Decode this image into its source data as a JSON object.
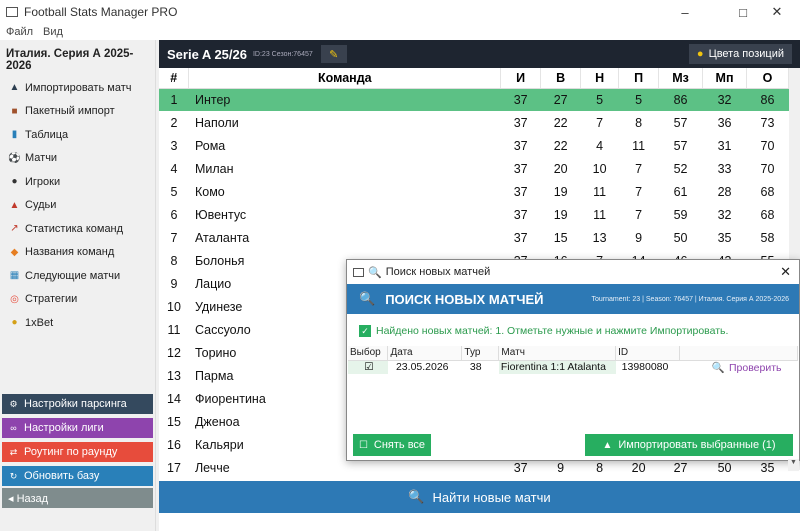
{
  "window": {
    "title": "Football Stats Manager PRO"
  },
  "menu": [
    "Файл",
    "Вид"
  ],
  "sidebar": {
    "league": "Италия. Серия А 2025-2026",
    "items": [
      {
        "label": "Импортировать матч",
        "icon": "import-icon"
      },
      {
        "label": "Пакетный импорт",
        "icon": "box-icon"
      },
      {
        "label": "Таблица",
        "icon": "bar-chart-icon"
      },
      {
        "label": "Матчи",
        "icon": "ball-icon"
      },
      {
        "label": "Игроки",
        "icon": "person-icon"
      },
      {
        "label": "Судьи",
        "icon": "referee-icon"
      },
      {
        "label": "Статистика команд",
        "icon": "line-chart-icon"
      },
      {
        "label": "Названия команд",
        "icon": "tag-icon"
      },
      {
        "label": "Следующие матчи",
        "icon": "calendar-icon"
      },
      {
        "label": "Стратегии",
        "icon": "target-icon"
      },
      {
        "label": "1xBet",
        "icon": "coin-icon"
      }
    ],
    "bottom_buttons": [
      {
        "label": "Настройки парсинга",
        "color": "#34495e",
        "icon": "gear-icon"
      },
      {
        "label": "Настройки лиги",
        "color": "#8e44ad",
        "icon": "link-icon"
      },
      {
        "label": "Роутинг по раунду",
        "color": "#e74c3c",
        "icon": "shuffle-icon"
      },
      {
        "label": "Обновить базу",
        "color": "#2980b9",
        "icon": "refresh-icon"
      },
      {
        "label": "◂ Назад",
        "color": "#7f8c8d",
        "icon": ""
      }
    ]
  },
  "main": {
    "header_title": "Serie A 25/26",
    "header_sub": "ID:23  Сезон:76457",
    "colors_button": "Цвета позиций",
    "find_button": "Найти новые матчи"
  },
  "table": {
    "columns": [
      "#",
      "Команда",
      "И",
      "В",
      "Н",
      "П",
      "Мз",
      "Мп",
      "О"
    ],
    "rows": [
      [
        "1",
        "Интер",
        "37",
        "27",
        "5",
        "5",
        "86",
        "32",
        "86"
      ],
      [
        "2",
        "Наполи",
        "37",
        "22",
        "7",
        "8",
        "57",
        "36",
        "73"
      ],
      [
        "3",
        "Рома",
        "37",
        "22",
        "4",
        "11",
        "57",
        "31",
        "70"
      ],
      [
        "4",
        "Милан",
        "37",
        "20",
        "10",
        "7",
        "52",
        "33",
        "70"
      ],
      [
        "5",
        "Комо",
        "37",
        "19",
        "11",
        "7",
        "61",
        "28",
        "68"
      ],
      [
        "6",
        "Ювентус",
        "37",
        "19",
        "11",
        "7",
        "59",
        "32",
        "68"
      ],
      [
        "7",
        "Аталанта",
        "37",
        "15",
        "13",
        "9",
        "50",
        "35",
        "58"
      ],
      [
        "8",
        "Болонья",
        "37",
        "16",
        "7",
        "14",
        "46",
        "43",
        "55"
      ],
      [
        "9",
        "Лацио",
        "",
        "",
        "",
        "",
        "",
        "",
        ""
      ],
      [
        "10",
        "Удинезе",
        "",
        "",
        "",
        "",
        "",
        "",
        ""
      ],
      [
        "11",
        "Сассуоло",
        "",
        "",
        "",
        "",
        "",
        "",
        ""
      ],
      [
        "12",
        "Торино",
        "",
        "",
        "",
        "",
        "",
        "",
        ""
      ],
      [
        "13",
        "Парма",
        "",
        "",
        "",
        "",
        "",
        "",
        ""
      ],
      [
        "14",
        "Фиорентина",
        "",
        "",
        "",
        "",
        "",
        "",
        ""
      ],
      [
        "15",
        "Дженоа",
        "",
        "",
        "",
        "",
        "",
        "",
        ""
      ],
      [
        "16",
        "Кальяри",
        "",
        "",
        "",
        "",
        "",
        "",
        ""
      ],
      [
        "17",
        "Лечче",
        "37",
        "9",
        "8",
        "20",
        "27",
        "50",
        "35"
      ]
    ],
    "leader_color": "#5cc185"
  },
  "dialog": {
    "title": "Поиск новых матчей",
    "banner": "ПОИСК НОВЫХ МАТЧЕЙ",
    "meta": "Tournament: 23  |  Season: 76457  |  Италия. Серия А 2025-2026",
    "found_text": "Найдено новых матчей: 1. Отметьте нужные и нажмите Импортировать.",
    "columns": [
      "Выбор",
      "Дата",
      "Тур",
      "Матч",
      "ID",
      ""
    ],
    "rows": [
      {
        "select": "☑",
        "date": "23.05.2026",
        "round": "38",
        "match": "Fiorentina 1:1 Atalanta",
        "id": "13980080",
        "action": "Проверить"
      }
    ],
    "deselect_button": "Снять все",
    "import_button": "Импортировать выбранные (1)"
  }
}
